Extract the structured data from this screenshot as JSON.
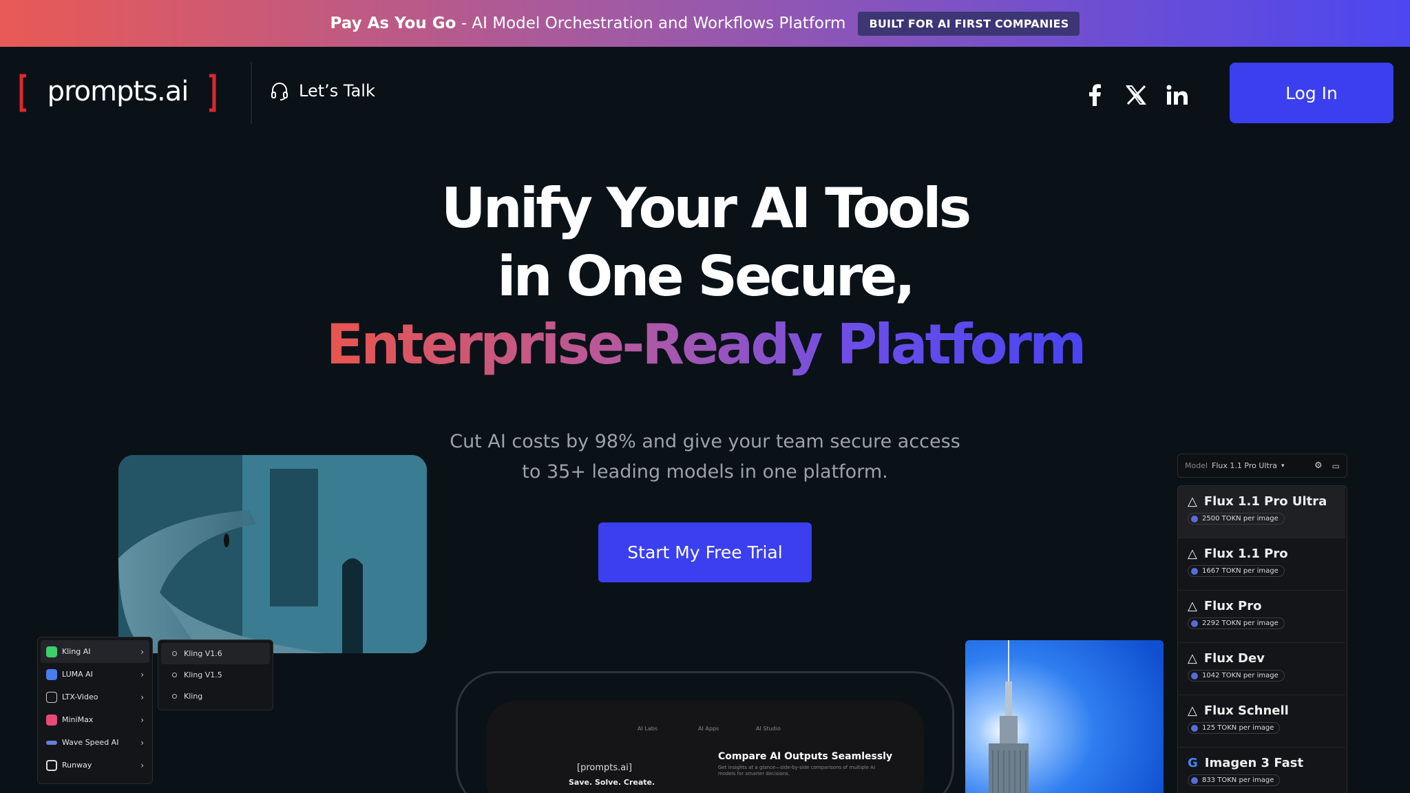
{
  "banner": {
    "title_bold": "Pay As You Go",
    "title_rest": "- AI Model Orchestration and Workflows Platform",
    "badge": "BUILT FOR AI FIRST COMPANIES"
  },
  "header": {
    "logo_text": "prompts.ai",
    "lets_talk": "Let’s Talk",
    "social": [
      "facebook-icon",
      "x-icon",
      "linkedin-icon"
    ],
    "login": "Log In"
  },
  "hero": {
    "line1": "Unify Your AI Tools",
    "line2": "in One Secure,",
    "line3": "Enterprise-Ready Platform",
    "subtitle_line1": "Cut AI costs by 98% and give your team secure access",
    "subtitle_line2": "to 35+ leading models in one platform.",
    "cta": "Start My Free Trial"
  },
  "provider_menu": {
    "items": [
      {
        "label": "Kling AI",
        "color": "#3ecf6a",
        "selected": true
      },
      {
        "label": "LUMA AI",
        "color": "#4a7cf0",
        "selected": false
      },
      {
        "label": "LTX-Video",
        "color": "#cccccc",
        "selected": false
      },
      {
        "label": "MiniMax",
        "color": "#e84a78",
        "selected": false
      },
      {
        "label": "Wave Speed AI",
        "color": "#6a7fd8",
        "selected": false
      },
      {
        "label": "Runway",
        "color": "#dddddd",
        "selected": false
      }
    ],
    "submenu": [
      "Kling V1.6",
      "Kling V1.5",
      "Kling"
    ]
  },
  "device_preview": {
    "tabs": [
      "AI Labs",
      "AI Apps",
      "AI Studio"
    ],
    "logo_text": "[prompts.ai]",
    "tagline": "Save. Solve. Create.",
    "heading": "Compare AI Outputs Seamlessly",
    "body": "Get insights at a glance—side-by-side comparisons of multiple AI models for smarter decisions."
  },
  "model_panel": {
    "label": "Model",
    "selected": "Flux 1.1 Pro Ultra",
    "models": [
      {
        "name": "Flux 1.1 Pro Ultra",
        "cost": "2500 TOKN per image"
      },
      {
        "name": "Flux 1.1 Pro",
        "cost": "1667 TOKN per image"
      },
      {
        "name": "Flux Pro",
        "cost": "2292 TOKN per image"
      },
      {
        "name": "Flux Dev",
        "cost": "1042 TOKN per image"
      },
      {
        "name": "Flux Schnell",
        "cost": "125 TOKN per image"
      },
      {
        "name": "Imagen 3 Fast",
        "cost": "833 TOKN per image"
      }
    ]
  }
}
